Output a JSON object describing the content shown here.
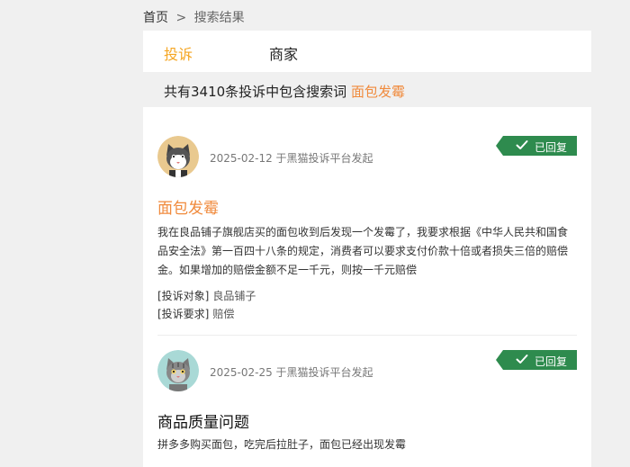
{
  "breadcrumb": {
    "home": "首页",
    "separator": ">",
    "current": "搜索结果"
  },
  "tabs": [
    {
      "label": "投诉"
    },
    {
      "label": "商家"
    }
  ],
  "summary": {
    "prefix": "共有3410条投诉中包含搜索词",
    "keyword": "面包发霉"
  },
  "complaints": [
    {
      "meta": "2025-02-12 于黑猫投诉平台发起",
      "status": "已回复",
      "title": "面包发霉",
      "body": "我在良品铺子旗舰店买的面包收到后发现一个发霉了，我要求根据《中华人民共和国食品安全法》第一百四十八条的规定，消费者可以要求支付价款十倍或者损失三倍的赔偿金。如果增加的赔偿金额不足一千元，则按一千元赔偿",
      "target_label": "[投诉对象]",
      "target_value": "良品铺子",
      "demand_label": "[投诉要求]",
      "demand_value": "赔偿"
    },
    {
      "meta": "2025-02-25 于黑猫投诉平台发起",
      "status": "已回复",
      "title": "商品质量问题",
      "body": "拼多多购买面包，吃完后拉肚子，面包已经出现发霉"
    }
  ],
  "colors": {
    "accent": "#f5a623",
    "keyword": "#f08a3c",
    "badge": "#2e8b4e"
  },
  "icons": {
    "avatar": "cat-avatar-icon",
    "check": "check-icon"
  }
}
